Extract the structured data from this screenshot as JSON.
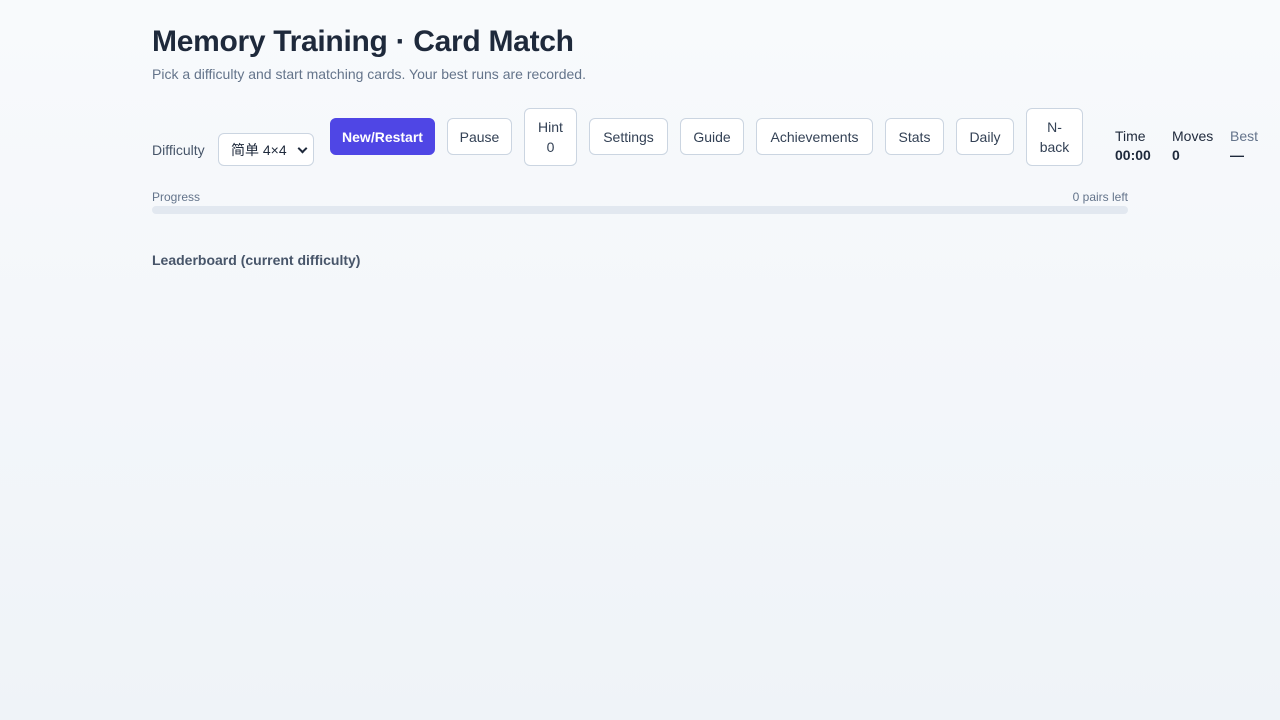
{
  "header": {
    "title": "Memory Training · Card Match",
    "subtitle": "Pick a difficulty and start matching cards. Your best runs are recorded."
  },
  "toolbar": {
    "difficulty_label": "Difficulty",
    "difficulty_value": "简单 4×4",
    "new_restart": "New/Restart",
    "pause": "Pause",
    "hint_label": "Hint",
    "hint_count": "0",
    "settings": "Settings",
    "guide": "Guide",
    "achievements": "Achievements",
    "stats": "Stats",
    "daily": "Daily",
    "nback_line1": "N-",
    "nback_line2": "back"
  },
  "stats": {
    "time_label": "Time",
    "time_value": "00:00",
    "moves_label": "Moves",
    "moves_value": "0",
    "best_label": "Best",
    "best_value": "—"
  },
  "progress": {
    "label": "Progress",
    "remaining": "0 pairs left",
    "fraction": 0
  },
  "leaderboard": {
    "title": "Leaderboard (current difficulty)"
  },
  "colors": {
    "accent": "#4f46e5",
    "text": "#1e293b",
    "muted": "#64748b"
  }
}
